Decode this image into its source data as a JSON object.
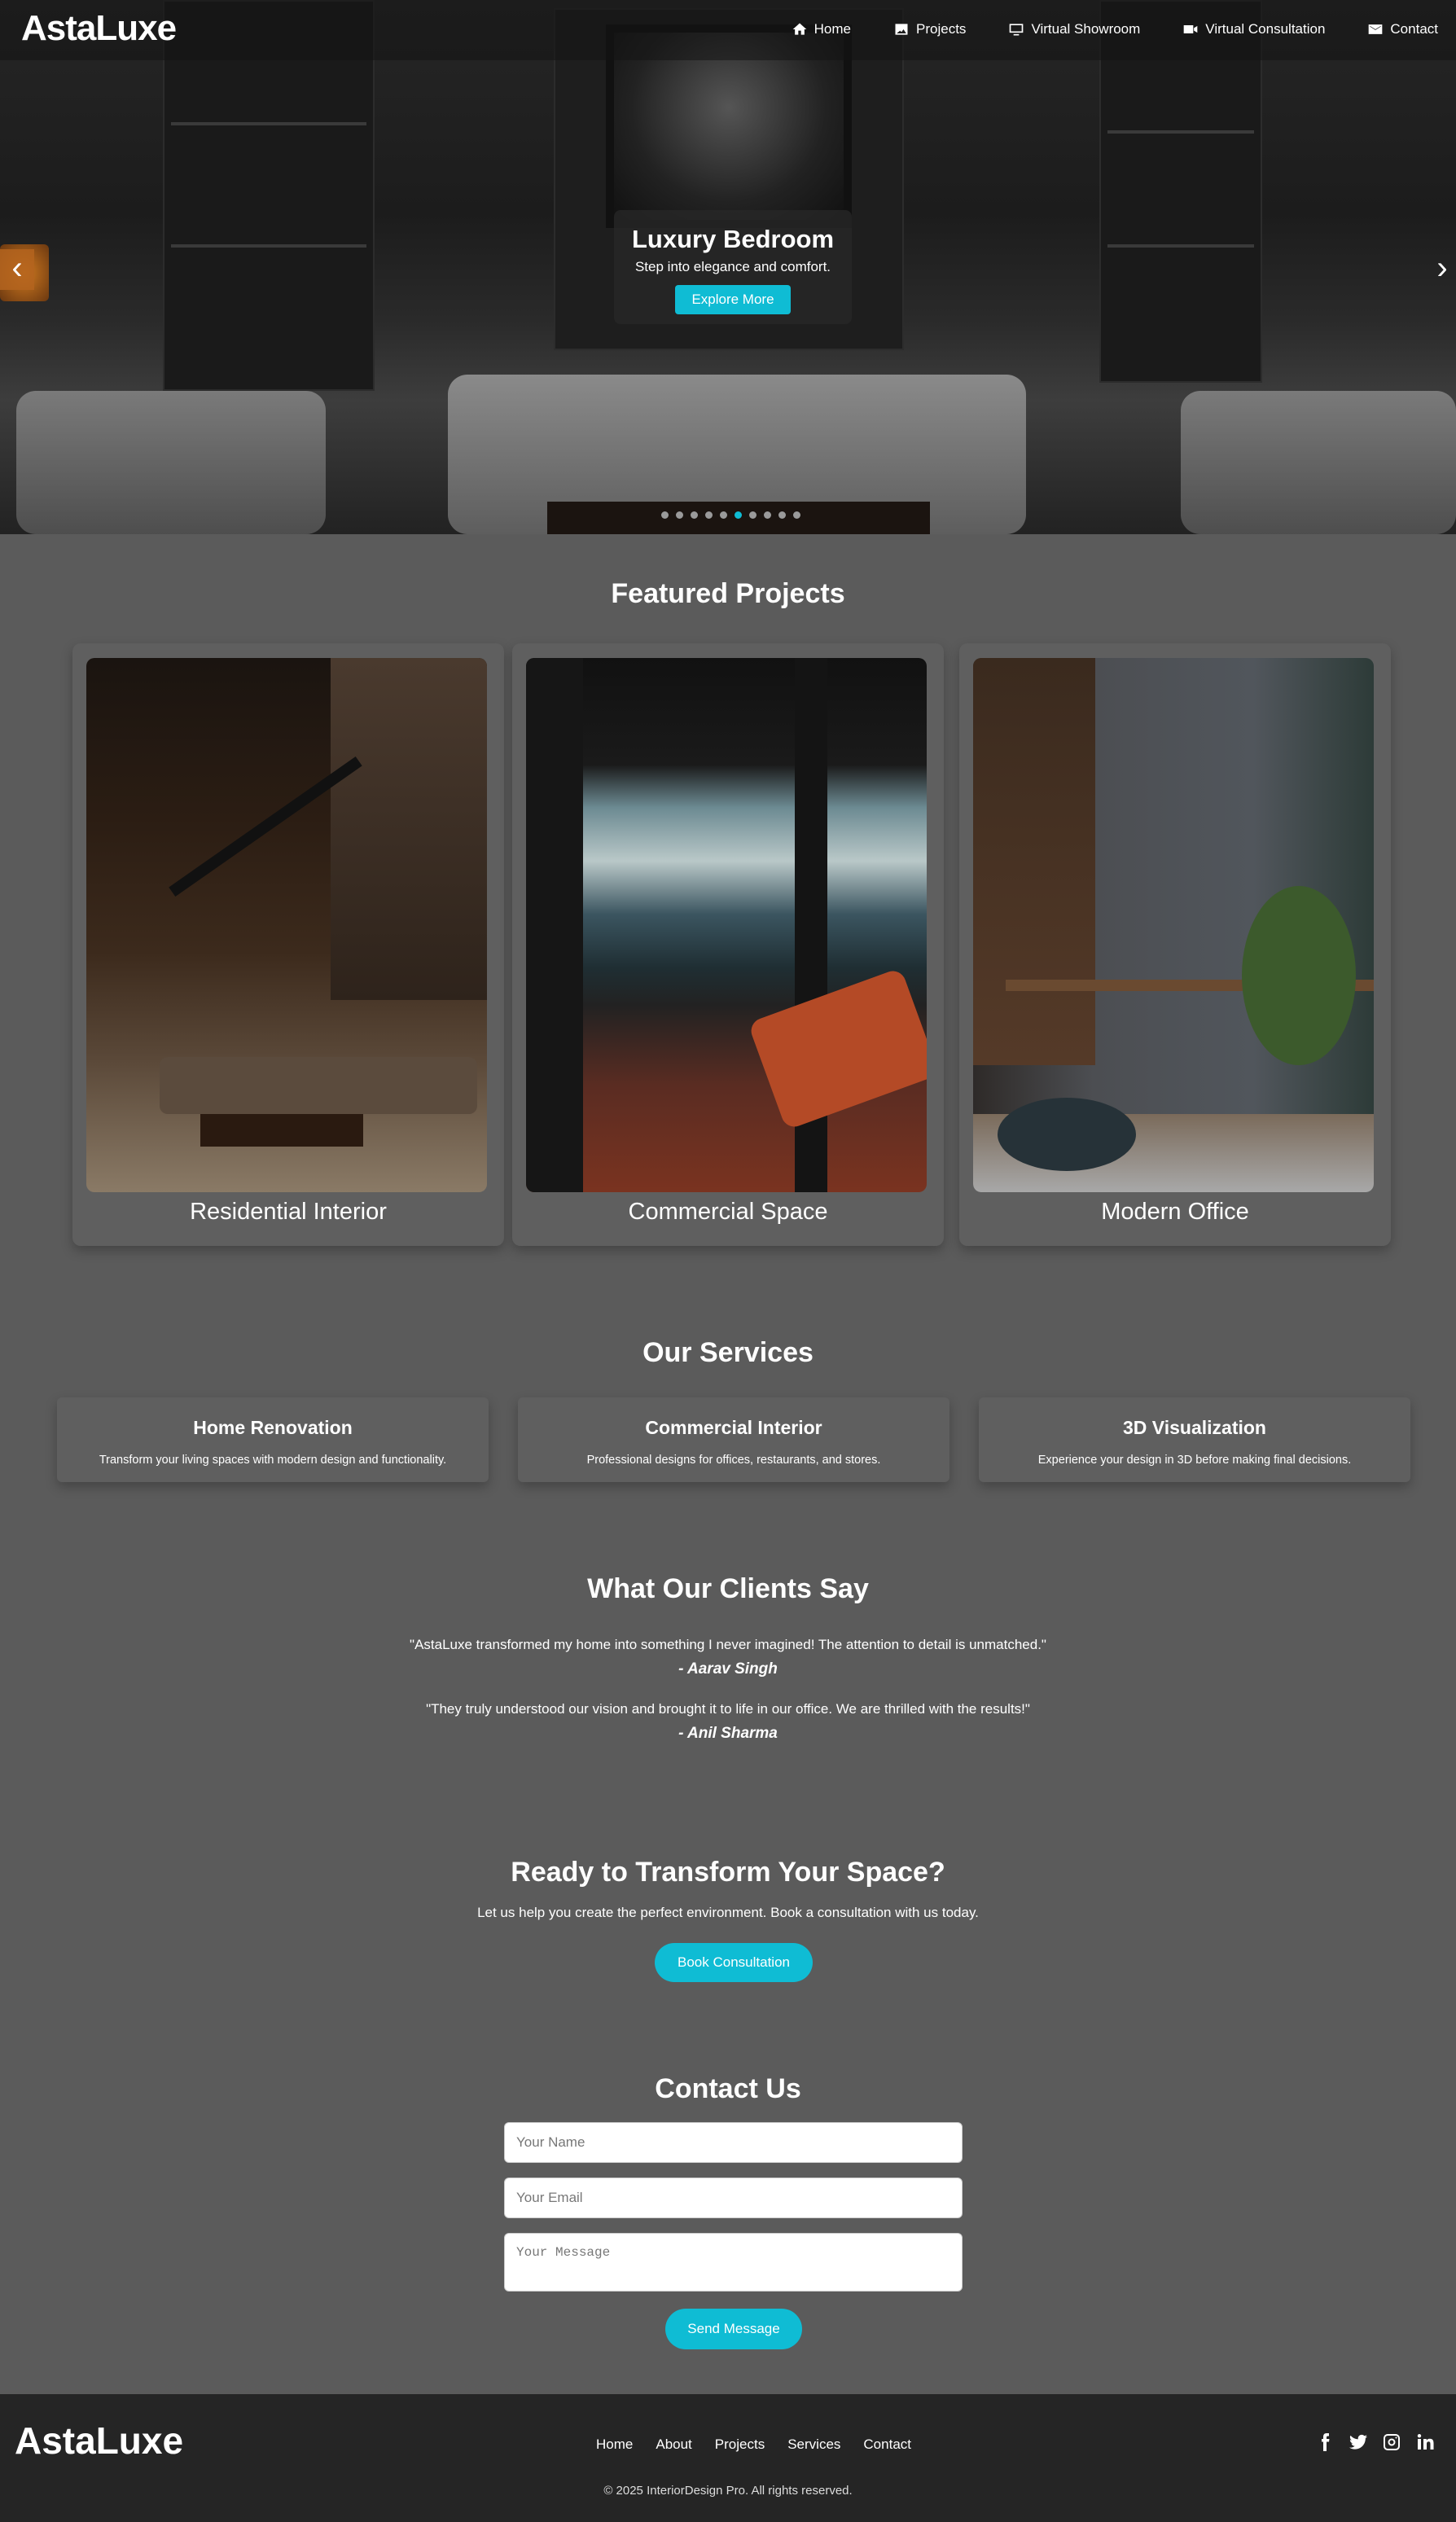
{
  "header": {
    "logo": "AstaLuxe",
    "nav": [
      {
        "label": "Home",
        "icon": "home-icon"
      },
      {
        "label": "Projects",
        "icon": "image-icon"
      },
      {
        "label": "Virtual Showroom",
        "icon": "monitor-icon"
      },
      {
        "label": "Virtual Consultation",
        "icon": "video-icon"
      },
      {
        "label": "Contact",
        "icon": "envelope-icon"
      }
    ]
  },
  "hero": {
    "title": "Luxury Bedroom",
    "subtitle": "Step into elegance and comfort.",
    "button": "Explore More",
    "prev": "‹",
    "next": "›",
    "slide_count": 10,
    "active_slide": 6
  },
  "projects": {
    "title": "Featured Projects",
    "items": [
      {
        "caption": "Residential Interior"
      },
      {
        "caption": "Commercial Space"
      },
      {
        "caption": "Modern Office"
      }
    ]
  },
  "services": {
    "title": "Our Services",
    "items": [
      {
        "title": "Home Renovation",
        "text": "Transform your living spaces with modern design and functionality."
      },
      {
        "title": "Commercial Interior",
        "text": "Professional designs for offices, restaurants, and stores."
      },
      {
        "title": "3D Visualization",
        "text": "Experience your design in 3D before making final decisions."
      }
    ]
  },
  "testimonials": {
    "title": "What Our Clients Say",
    "items": [
      {
        "quote": "\"AstaLuxe transformed my home into something I never imagined! The attention to detail is unmatched.\"",
        "author": "- Aarav Singh"
      },
      {
        "quote": "\"They truly understood our vision and brought it to life in our office. We are thrilled with the results!\"",
        "author": "- Anil Sharma"
      }
    ]
  },
  "cta": {
    "title": "Ready to Transform Your Space?",
    "text": "Let us help you create the perfect environment. Book a consultation with us today.",
    "button": "Book Consultation"
  },
  "contact": {
    "title": "Contact Us",
    "name_placeholder": "Your Name",
    "email_placeholder": "Your Email",
    "message_placeholder": "Your Message",
    "button": "Send Message"
  },
  "footer": {
    "logo": "AstaLuxe",
    "links": [
      "Home",
      "About",
      "Projects",
      "Services",
      "Contact"
    ],
    "social": [
      "facebook-icon",
      "twitter-icon",
      "instagram-icon",
      "linkedin-icon"
    ],
    "copyright": "© 2025 InteriorDesign Pro. All rights reserved."
  },
  "colors": {
    "accent": "#0fbcd4",
    "background": "#5b5b5b",
    "footer": "#252525"
  }
}
